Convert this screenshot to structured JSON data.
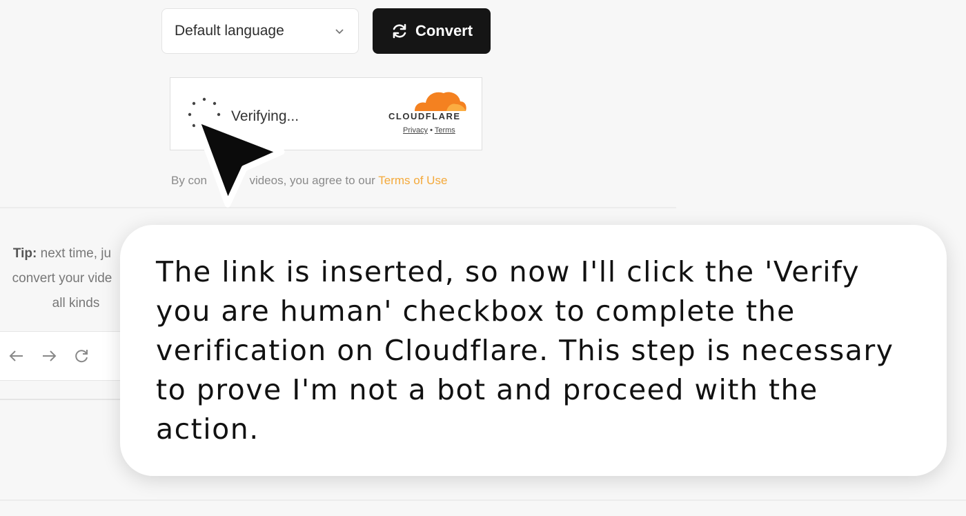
{
  "language_select": {
    "value": "Default language",
    "icon": "chevron-down-icon"
  },
  "convert_button": {
    "label": "Convert",
    "icon": "refresh-icon"
  },
  "captcha": {
    "status": "Verifying...",
    "brand": "CLOUDFLARE",
    "privacy_link": "Privacy",
    "separator": "•",
    "terms_link": "Terms",
    "brand_color": "#f48120"
  },
  "agreement": {
    "prefix": "By con",
    "middle": "videos, you agree to our",
    "terms_link": "Terms of Use",
    "link_color": "#f4a93a"
  },
  "tip": {
    "label": "Tip:",
    "line1": "next time, ju",
    "line2": "convert your vide",
    "line3": "all kinds"
  },
  "browser_nav": {
    "icons": [
      "back-arrow-icon",
      "forward-arrow-icon",
      "reload-icon"
    ]
  },
  "caption": {
    "text": "The link is inserted, so now I'll click the 'Verify you are human' checkbox to complete the verification on Cloudflare. This step is necessary to prove I'm not a bot and proceed with the action."
  }
}
